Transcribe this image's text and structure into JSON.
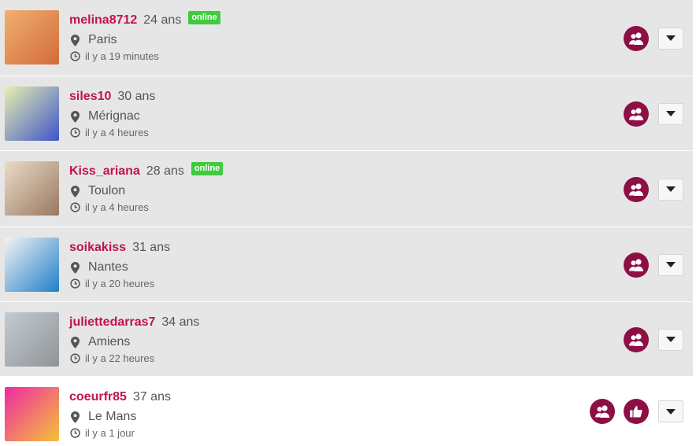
{
  "members": [
    {
      "username": "melina8712",
      "age": "24 ans",
      "online": true,
      "online_label": "online",
      "city": "Paris",
      "last_seen": "il y a 19 minutes",
      "avatar_colors": [
        "#f0b070",
        "#d46a3c"
      ],
      "actions": [
        "add-friend"
      ],
      "highlight": false
    },
    {
      "username": "siles10",
      "age": "30 ans",
      "online": false,
      "online_label": "",
      "city": "Mérignac",
      "last_seen": "il y a 4 heures",
      "avatar_colors": [
        "#e8efb0",
        "#3d56c8"
      ],
      "actions": [
        "add-friend"
      ],
      "highlight": false
    },
    {
      "username": "Kiss_ariana",
      "age": "28 ans",
      "online": true,
      "online_label": "online",
      "city": "Toulon",
      "last_seen": "il y a 4 heures",
      "avatar_colors": [
        "#e9dcc8",
        "#9a7860"
      ],
      "actions": [
        "add-friend"
      ],
      "highlight": false
    },
    {
      "username": "soikakiss",
      "age": "31 ans",
      "online": false,
      "online_label": "",
      "city": "Nantes",
      "last_seen": "il y a 20 heures",
      "avatar_colors": [
        "#f5f3f3",
        "#1f7fc8"
      ],
      "actions": [
        "add-friend"
      ],
      "highlight": false
    },
    {
      "username": "juliettedarras7",
      "age": "34 ans",
      "online": false,
      "online_label": "",
      "city": "Amiens",
      "last_seen": "il y a 22 heures",
      "avatar_colors": [
        "#c4cbd0",
        "#8f9498"
      ],
      "actions": [
        "add-friend"
      ],
      "highlight": false
    },
    {
      "username": "coeurfr85",
      "age": "37 ans",
      "online": false,
      "online_label": "",
      "city": "Le Mans",
      "last_seen": "il y a 1 jour",
      "avatar_colors": [
        "#ee2aa3",
        "#f4c23a"
      ],
      "actions": [
        "add-friend",
        "like"
      ],
      "highlight": true
    }
  ],
  "colors": {
    "username": "#c0134e",
    "action_button": "#8d0f44",
    "online_badge": "#3ecb3e",
    "row_bg": "#e6e6e6"
  },
  "icons": {
    "location": "map-pin-icon",
    "time": "clock-icon",
    "friend": "users-icon",
    "like": "thumbs-up-icon",
    "menu": "caret-down-icon"
  }
}
